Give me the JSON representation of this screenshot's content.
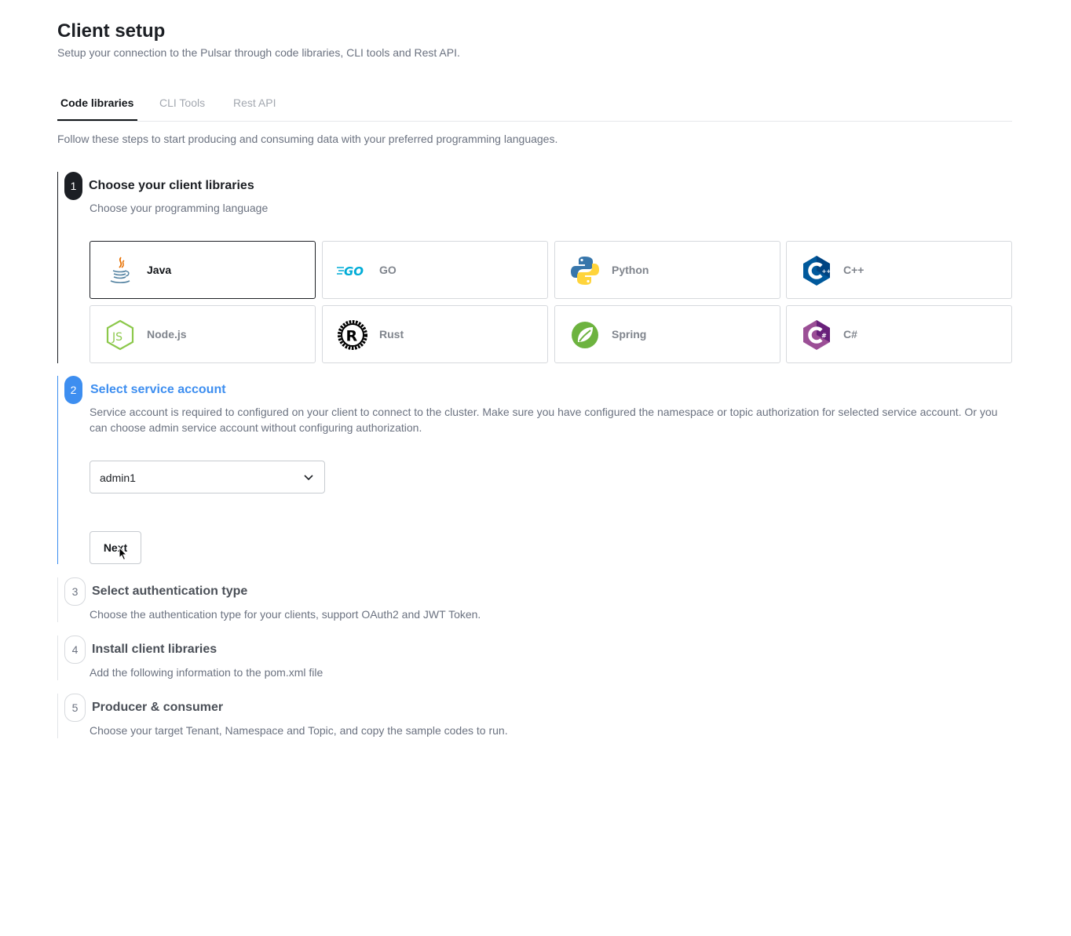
{
  "page": {
    "title": "Client setup",
    "subtitle": "Setup your connection to the Pulsar through code libraries, CLI tools and Rest API."
  },
  "tabs": [
    {
      "label": "Code libraries",
      "active": true
    },
    {
      "label": "CLI Tools",
      "active": false
    },
    {
      "label": "Rest API",
      "active": false
    }
  ],
  "intro": "Follow these steps to start producing and consuming data with your preferred programming languages.",
  "steps": [
    {
      "number": "1",
      "title": "Choose your client libraries",
      "description": "Choose your programming language"
    },
    {
      "number": "2",
      "title": "Select service account",
      "description": "Service account is required to configured on your client to connect to the cluster. Make sure you have configured the namespace or topic authorization for selected service account. Or you can choose admin service account without configuring authorization."
    },
    {
      "number": "3",
      "title": "Select authentication type",
      "description": "Choose the authentication type for your clients, support OAuth2 and JWT Token."
    },
    {
      "number": "4",
      "title": "Install client libraries",
      "description": "Add the following information to the pom.xml file"
    },
    {
      "number": "5",
      "title": "Producer & consumer",
      "description": "Choose your target Tenant, Namespace and Topic, and copy the sample codes to run."
    }
  ],
  "languages": [
    {
      "label": "Java",
      "icon": "java-icon",
      "selected": true
    },
    {
      "label": "GO",
      "icon": "go-icon",
      "selected": false
    },
    {
      "label": "Python",
      "icon": "python-icon",
      "selected": false
    },
    {
      "label": "C++",
      "icon": "cpp-icon",
      "selected": false
    },
    {
      "label": "Node.js",
      "icon": "nodejs-icon",
      "selected": false
    },
    {
      "label": "Rust",
      "icon": "rust-icon",
      "selected": false
    },
    {
      "label": "Spring",
      "icon": "spring-icon",
      "selected": false
    },
    {
      "label": "C#",
      "icon": "csharp-icon",
      "selected": false
    }
  ],
  "service_account": {
    "selected": "admin1"
  },
  "buttons": {
    "next_label": "Next"
  },
  "colors": {
    "accent": "#3d8ef0",
    "dark": "#1c1f24",
    "muted": "#6b7280"
  }
}
